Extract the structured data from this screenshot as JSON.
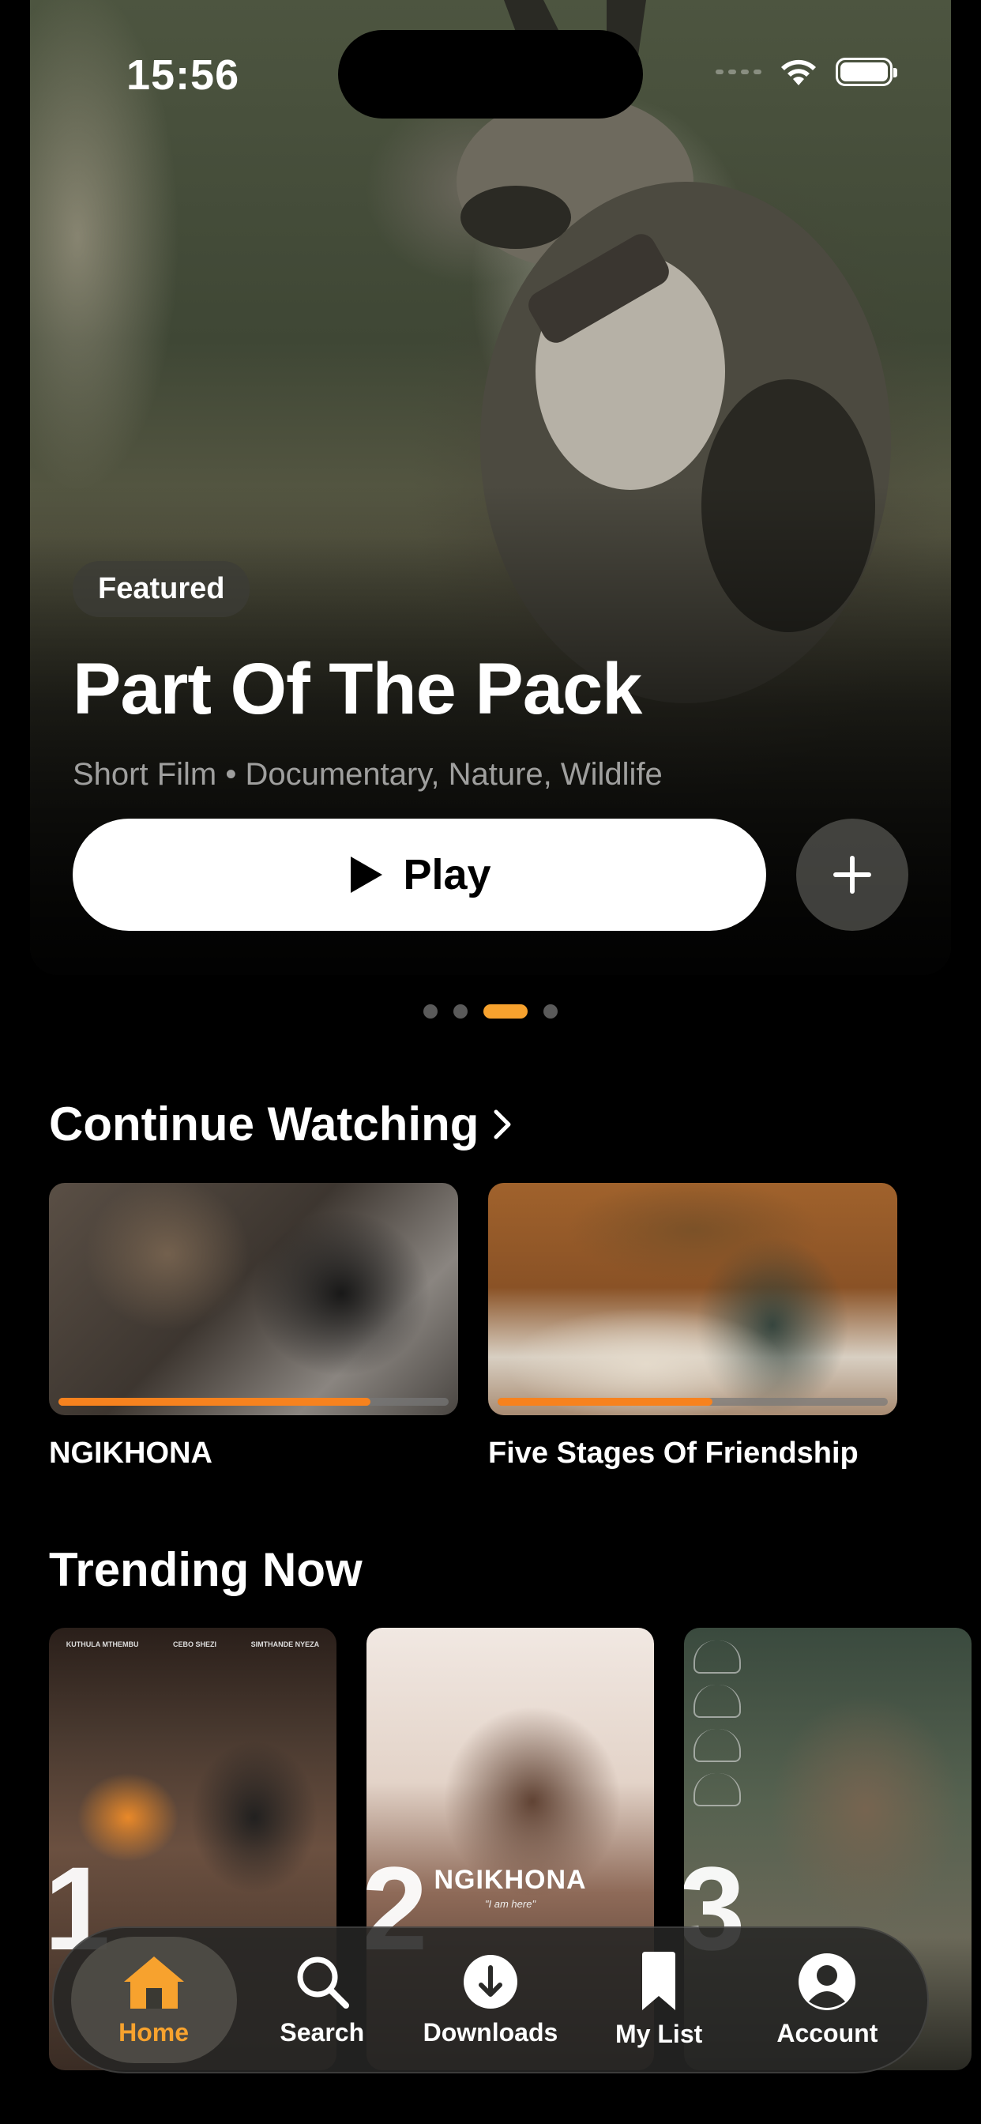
{
  "status_bar": {
    "time": "15:56"
  },
  "hero": {
    "badge": "Featured",
    "title": "Part Of The Pack",
    "meta": "Short Film • Documentary, Nature, Wildlife",
    "play_label": "Play",
    "pager": {
      "count": 4,
      "active_index": 2
    }
  },
  "continue_watching": {
    "title": "Continue Watching",
    "items": [
      {
        "label": "NGIKHONA",
        "progress": 0.8
      },
      {
        "label": "Five Stages Of Friendship",
        "progress": 0.55
      }
    ]
  },
  "trending": {
    "title": "Trending Now",
    "items": [
      {
        "rank": "1",
        "credits": [
          "KUTHULA MTHEMBU",
          "CEBO SHEZI",
          "SIMTHANDE NYEZA"
        ]
      },
      {
        "rank": "2",
        "poster_title": "NGIKHONA",
        "poster_sub": "\"I am here\""
      },
      {
        "rank": "3"
      }
    ]
  },
  "tabbar": {
    "tabs": [
      {
        "label": "Home",
        "icon": "home-icon",
        "active": true
      },
      {
        "label": "Search",
        "icon": "search-icon"
      },
      {
        "label": "Downloads",
        "icon": "download-icon"
      },
      {
        "label": "My List",
        "icon": "bookmark-icon"
      },
      {
        "label": "Account",
        "icon": "account-icon"
      }
    ]
  },
  "colors": {
    "accent": "#f7a22e",
    "progress": "#f7821e"
  }
}
